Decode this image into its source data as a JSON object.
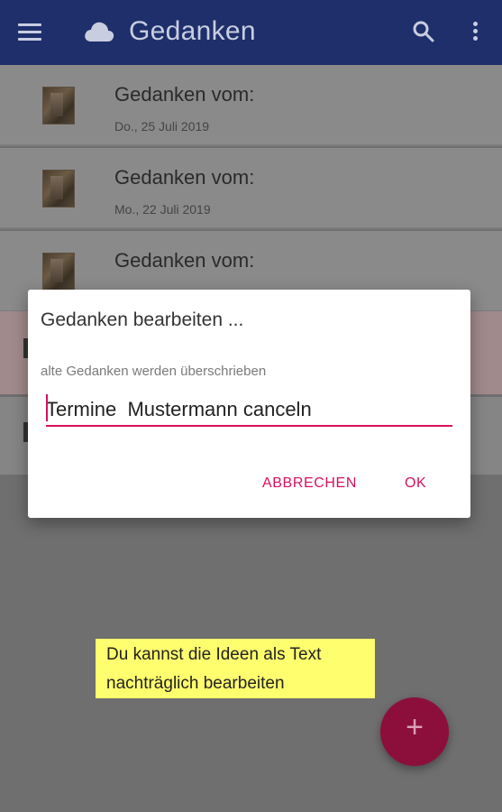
{
  "app": {
    "title": "Gedanken",
    "icons": {
      "menu": "menu-icon",
      "logo": "cloud-icon",
      "search": "search-icon",
      "more": "more-vert-icon",
      "fab": "plus-icon"
    },
    "colors": {
      "primary": "#1e2f6b",
      "accent": "#d6115f",
      "fab": "#8c0f3b"
    }
  },
  "list": {
    "items": [
      {
        "title": "Gedanken vom:",
        "date": "Do., 25 Juli 2019"
      },
      {
        "title": "Gedanken vom:",
        "date": "Mo., 22 Juli 2019"
      },
      {
        "title": "Gedanken vom:",
        "date": ""
      }
    ]
  },
  "dialog": {
    "title": "Gedanken bearbeiten ...",
    "subtitle": "alte Gedanken werden überschrieben",
    "input_value": "Termine  Mustermann canceln",
    "cancel_label": "ABBRECHEN",
    "ok_label": "OK"
  },
  "hint": {
    "line1": "Du kannst die Ideen als Text",
    "line2": "nachträglich bearbeiten"
  },
  "fab": {
    "label": "+"
  }
}
